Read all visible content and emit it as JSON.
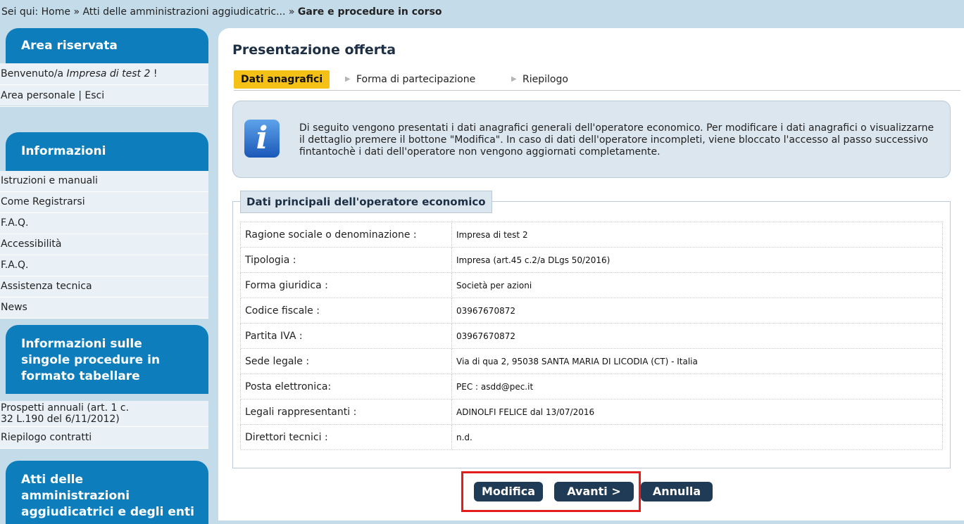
{
  "breadcrumb": {
    "prefix": "Sei qui: ",
    "home": "Home",
    "sep": " » ",
    "parent": "Atti delle amministrazioni aggiudicatric...",
    "current": "Gare e procedure in corso"
  },
  "sidebar": {
    "area_riservata": {
      "title": "Area riservata",
      "welcome_prefix": "Benvenuto/a ",
      "welcome_user": "Impresa di test 2",
      "welcome_suffix": " !",
      "area_personale": "Area personale",
      "sep": " | ",
      "esci": "Esci"
    },
    "informazioni": {
      "title": "Informazioni",
      "items": [
        "Istruzioni e manuali",
        "Come Registrarsi",
        "F.A.Q.",
        "Accessibilità",
        "F.A.Q.",
        "Assistenza tecnica",
        "News"
      ]
    },
    "procedure": {
      "title_lines": [
        "Informazioni sulle",
        "singole procedure in",
        "formato tabellare"
      ],
      "items": [
        "Prospetti annuali (art. 1 c.",
        "32 L.190 del 6/11/2012)",
        "Riepilogo contratti"
      ]
    },
    "atti": {
      "title_lines": [
        "Atti delle",
        "amministrazioni",
        "aggiudicatrici e degli enti"
      ]
    }
  },
  "main": {
    "title": "Presentazione offerta",
    "steps": [
      "Dati anagrafici",
      "Forma di partecipazione",
      "Riepilogo"
    ],
    "info_text": "Di seguito vengono presentati i dati anagrafici generali dell'operatore economico. Per modificare i dati anagrafici o visualizzarne il dettaglio premere il bottone \"Modifica\". In caso di dati dell'operatore incompleti, viene bloccato l'accesso al passo successivo fintantochè i dati dell'operatore non vengono aggiornati completamente.",
    "section_title": "Dati principali dell'operatore economico",
    "rows": [
      {
        "label": "Ragione sociale o denominazione :",
        "value": "Impresa di test 2"
      },
      {
        "label": "Tipologia :",
        "value": "Impresa (art.45 c.2/a DLgs 50/2016)"
      },
      {
        "label": "Forma giuridica :",
        "value": "Società per azioni"
      },
      {
        "label": "Codice fiscale :",
        "value": "03967670872"
      },
      {
        "label": "Partita IVA :",
        "value": "03967670872"
      },
      {
        "label": "Sede legale :",
        "value": "Via di qua 2, 95038 SANTA MARIA DI LICODIA (CT) - Italia"
      },
      {
        "label": "Posta elettronica:",
        "value": "PEC : asdd@pec.it"
      },
      {
        "label": "Legali rappresentanti :",
        "value": "ADINOLFI FELICE dal 13/07/2016"
      },
      {
        "label": "Direttori tecnici :",
        "value": "n.d."
      }
    ],
    "buttons": {
      "modifica": "Modifica",
      "avanti": "Avanti >",
      "annulla": "Annulla"
    }
  },
  "colors": {
    "accent": "#0d7dbb",
    "step_active": "#f5c116",
    "button": "#203b55",
    "highlight": "#e41c1c"
  },
  "icons": {
    "info": "info-icon",
    "step_arrow": "triangle-right-icon"
  }
}
